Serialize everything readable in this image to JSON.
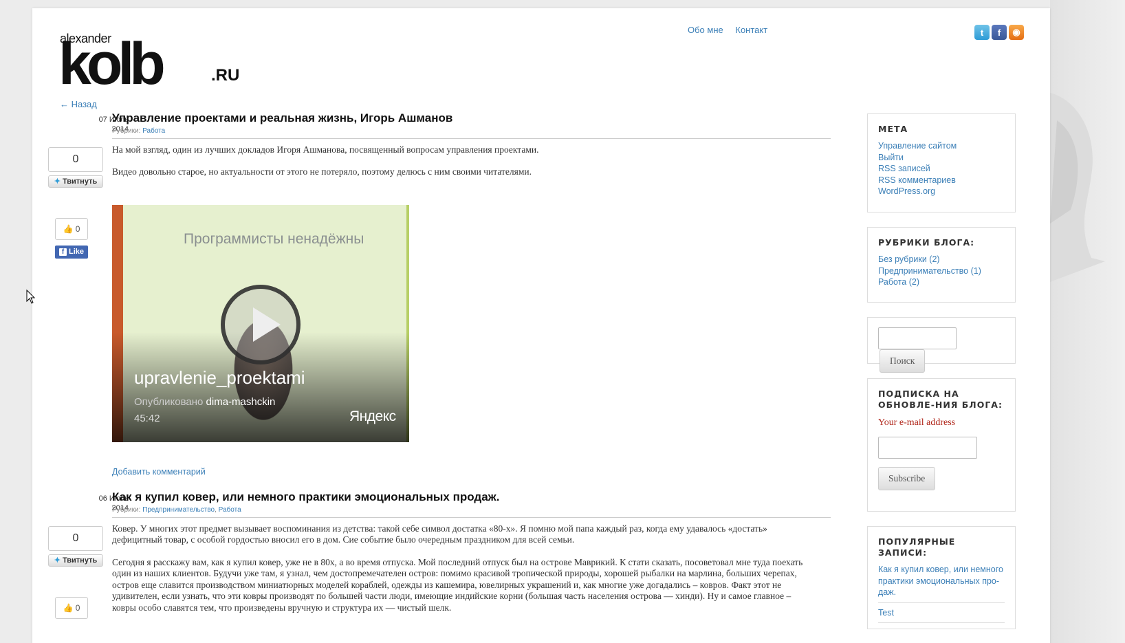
{
  "header": {
    "logo": {
      "small": "alexander",
      "big": "kolb",
      "suffix": ".RU"
    },
    "nav": [
      "Обо мне",
      "Контакт"
    ],
    "social": [
      "twitter-icon",
      "facebook-icon",
      "rss-icon"
    ],
    "back_link": "← Назад"
  },
  "posts": [
    {
      "date_day": "07 Июль",
      "date_year": "2014",
      "tweet_count": "0",
      "tweet_label": "Твитнуть",
      "like_count": "0",
      "like_label": "Like",
      "title": "Управление проектами и реальная жизнь, Игорь Ашманов",
      "cats_prefix": "Рубрики:",
      "cats": [
        "Работа"
      ],
      "paragraphs": [
        "На мой взгляд, один из лучших докладов Игоря Ашманова, посвященный вопросам управления проектами.",
        "Видео довольно старое, но актуальности от этого не потеряло, поэтому делюсь с ним своими читателями."
      ],
      "video": {
        "slide_text": "Программисты ненадёжны",
        "title": "upravlenie_proektami",
        "published_prefix": "Опубликовано",
        "author": "dima-mashckin",
        "duration": "45:42",
        "brand": "Яндекс"
      },
      "add_comment": "Добавить комментарий"
    },
    {
      "date_day": "06 Июль",
      "date_year": "2014",
      "tweet_count": "0",
      "tweet_label": "Твитнуть",
      "like_count": "0",
      "title": "Как я купил ковер, или немного практики эмоциональных продаж.",
      "cats_prefix": "Рубрики:",
      "cats": [
        "Предпринимательство",
        "Работа"
      ],
      "paragraphs": [
        "Ковер. У многих этот предмет вызывает воспоминания из детства: такой себе символ достатка «80-х». Я помню мой папа каждый раз, когда ему удавалось «достать» дефицитный товар, с особой гордостью вносил его в дом. Сие событие было очередным праздником для всей семьи.",
        "Сегодня я расскажу вам, как я купил ковер, уже не в 80х, а во время отпуска. Мой последний отпуск был на острове Маврикий. К стати сказать, посоветовал мне туда поехать один из наших клиентов. Будучи уже там, я узнал, чем достопремечателен остров: помимо красивой тропической природы, хорошей рыбалки на марлина, больших черепах, остров еще славится производством миниатюрных моделей кораблей, одежды из кашемира, ювелирных украшений и, как многие уже догадались – ковров. Факт этот не удивителен, если узнать, что эти ковры производят по большей части люди, имеющие индийские корни (большая часть населения острова — хинди). Ну и самое главное – ковры особо славятся тем, что произведены вручную и структура их — чистый шелк."
      ]
    }
  ],
  "sidebar": {
    "meta": {
      "title": "МЕТА",
      "links": [
        "Управление сайтом",
        "Выйти",
        "RSS записей",
        "RSS комментариев",
        "WordPress.org"
      ]
    },
    "categories": {
      "title": "РУБРИКИ БЛОГА:",
      "links": [
        "Без рубрики (2)",
        "Предпринимательство (1)",
        "Работа (2)"
      ]
    },
    "search": {
      "button": "Поиск",
      "value": ""
    },
    "subscribe": {
      "title": "ПОДПИСКА НА ОБНОВЛЕ-НИЯ БЛОГА:",
      "email_label": "Your e-mail address",
      "button": "Subscribe"
    },
    "popular": {
      "title": "ПОПУЛЯРНЫЕ ЗАПИСИ:",
      "links": [
        "Как я купил ковер, или немного практики эмоциональных про-даж.",
        "Test"
      ]
    }
  }
}
